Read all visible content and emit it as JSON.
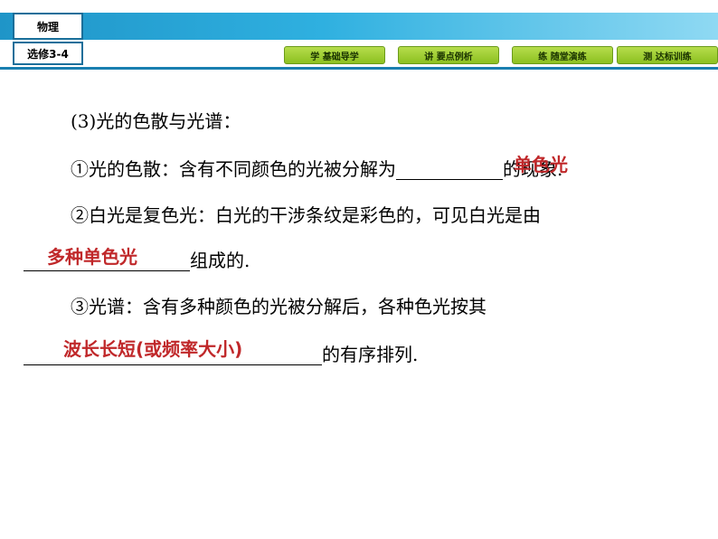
{
  "header": {
    "subject": "物理",
    "module": "选修3-4",
    "nav": [
      "学 基础导学",
      "讲 要点例析",
      "练 随堂演练",
      "测 达标训练"
    ]
  },
  "content": {
    "heading": "(3)光的色散与光谱：",
    "item1_prefix": "①光的色散：含有不同颜色的光被分解为",
    "item1_suffix": "的现象.",
    "item1_answer": "单色光",
    "item2_line1": "②白光是复色光：白光的干涉条纹是彩色的，可见白光是由",
    "item2_suffix": "组成的.",
    "item2_answer": "多种单色光",
    "item3_line1": "③光谱：含有多种颜色的光被分解后，各种色光按其",
    "item3_suffix": "的有序排列.",
    "item3_answer": "波长长短(或频率大小)"
  }
}
